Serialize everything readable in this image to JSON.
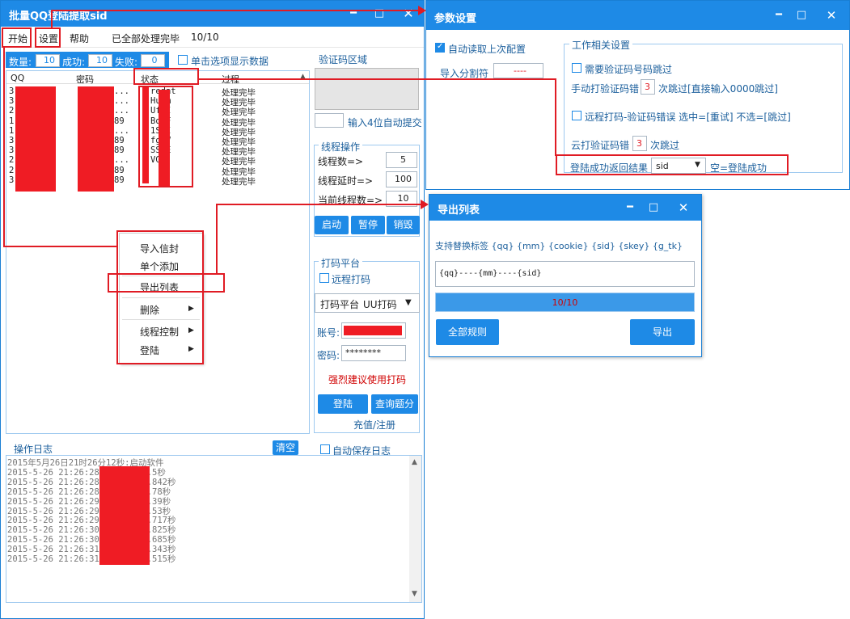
{
  "main": {
    "title": "批量QQ登陆提取sid",
    "menu": {
      "start": "开始",
      "settings": "设置",
      "help": "帮助",
      "status": "已全部处理完毕",
      "progress": "10/10"
    },
    "stats": {
      "count_label": "数量:",
      "count": "10",
      "success_label": "成功:",
      "success": "10",
      "fail_label": "失败:",
      "fail": "0",
      "single_click_label": "单击选项显示数据"
    },
    "table": {
      "headers": [
        "QQ",
        "密码",
        "状态",
        "过程"
      ],
      "rows": [
        {
          "qq": "3",
          "pw": "...",
          "st": "redat",
          "pr": "处理完毕"
        },
        {
          "qq": "3",
          "pw": "...",
          "st": "Hufm",
          "pr": "处理完毕"
        },
        {
          "qq": "2",
          "pw": "...",
          "st": "UfTI",
          "pr": "处理完毕"
        },
        {
          "qq": "1",
          "pw": "89",
          "st": "BqoF",
          "pr": "处理完毕"
        },
        {
          "qq": "1",
          "pw": "...",
          "st": "1SUI",
          "pr": "处理完毕"
        },
        {
          "qq": "3",
          "pw": "89",
          "st": "fgSV",
          "pr": "处理完毕"
        },
        {
          "qq": "3",
          "pw": "89",
          "st": "SSGE",
          "pr": "处理完毕"
        },
        {
          "qq": "2",
          "pw": "...",
          "st": "VGD",
          "pr": "处理完毕"
        },
        {
          "qq": "2",
          "pw": "89",
          "st": "",
          "pr": "处理完毕"
        },
        {
          "qq": "3",
          "pw": "89",
          "st": "",
          "pr": "处理完毕"
        }
      ]
    },
    "context_menu": [
      "导入信封",
      "单个添加",
      "导出列表",
      "删除",
      "线程控制",
      "登陆"
    ],
    "captcha": {
      "title": "验证码区域",
      "auto_submit": "输入4位自动提交"
    },
    "threads": {
      "title": "线程操作",
      "count_label": "线程数=>",
      "count": "5",
      "delay_label": "线程延时=>",
      "delay": "100",
      "current_label": "当前线程数=>",
      "current": "10",
      "start": "启动",
      "pause": "暂停",
      "destroy": "销毁"
    },
    "captcha_platform": {
      "title": "打码平台",
      "remote_label": "远程打码",
      "platform_label": "打码平台",
      "platform_value": "UU打码",
      "account_label": "账号:",
      "password_label": "密码:",
      "password_value": "********",
      "warning": "强烈建议使用打码",
      "login": "登陆",
      "query": "查询题分",
      "recharge": "充值/注册"
    },
    "log": {
      "title": "操作日志",
      "clear": "清空",
      "auto_save": "自动保存日志",
      "lines": [
        "2015年5月26日21时26分12秒:启动软件",
        "2015-5-26 21:26:28:          [用时] 0.5秒",
        "2015-5-26 21:26:28:          [用时] 0.842秒",
        "2015-5-26 21:26:28:          [用时] 0.78秒",
        "2015-5-26 21:26:29:          [用时] 0.39秒",
        "2015-5-26 21:26:29:          [用时] 0.53秒",
        "2015-5-26 21:26:29:          [用时] 0.717秒",
        "2015-5-26 21:26:30:          [用时] 1.825秒",
        "2015-5-26 21:26:30:          [用时] 1.685秒",
        "2015-5-26 21:26:31:          [用时] 0.343秒",
        "2015-5-26 21:26:31:          [用时] 0.515秒"
      ]
    }
  },
  "settings": {
    "title": "参数设置",
    "auto_read": "自动读取上次配置",
    "import_sep_label": "导入分割符",
    "import_sep_value": "----",
    "work_title": "工作相关设置",
    "need_captcha_skip": "需要验证码号码跳过",
    "manual_captcha_label": "手动打验证码错",
    "manual_captcha_value": "3",
    "manual_captcha_suffix": "次跳过[直接输入0000跳过]",
    "remote_captcha": "远程打码-验证码错误 选中=[重试] 不选=[跳过]",
    "cloud_captcha_label": "云打验证码错",
    "cloud_captcha_value": "3",
    "cloud_captcha_suffix": "次跳过",
    "login_result_label": "登陆成功返回结果",
    "login_result_value": "sid",
    "login_result_hint": "空=登陆成功"
  },
  "export": {
    "title": "导出列表",
    "tags_label": "支持替换标签 {qq} {mm} {cookie} {sid} {skey} {g_tk}",
    "template": "{qq}----{mm}----{sid}",
    "progress_text": "10/10",
    "progress": 1.0,
    "all_rules": "全部规则",
    "export_btn": "导出"
  },
  "colors": {
    "accent": "#1e8ae6",
    "annotation": "#e01b24",
    "redact": "#ef1c24"
  }
}
